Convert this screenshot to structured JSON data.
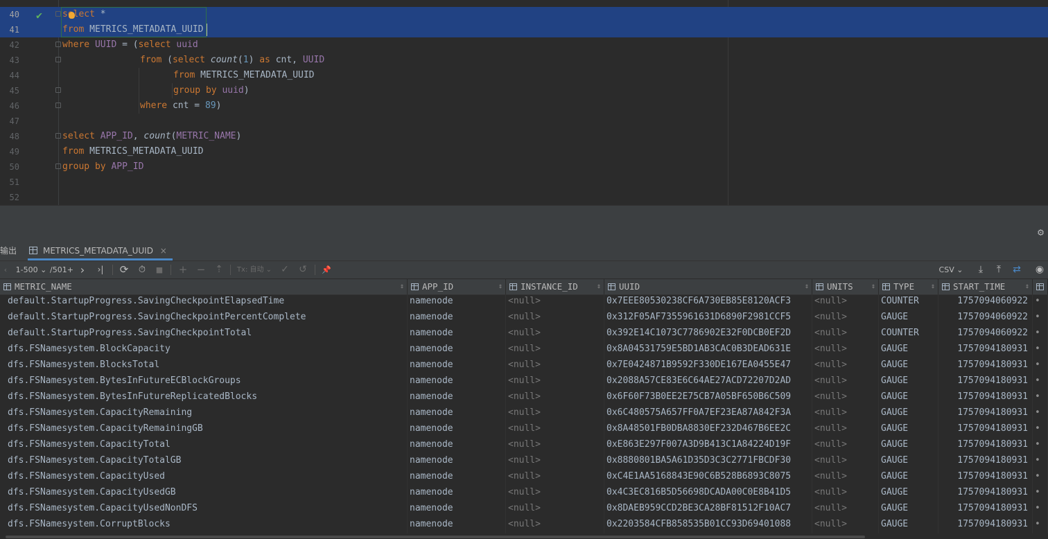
{
  "editor": {
    "lines": [
      {
        "n": "40",
        "sel": true,
        "fold": true,
        "check": true,
        "indent": 0,
        "tokens": [
          {
            "t": "select",
            "c": "kw"
          },
          {
            "t": " *",
            "c": "id"
          }
        ]
      },
      {
        "n": "41",
        "sel": true,
        "fold": false,
        "check": false,
        "indent": 0,
        "tokens": [
          {
            "t": "from",
            "c": "kw"
          },
          {
            "t": " METRICS_METADATA_UUID",
            "c": "id"
          }
        ]
      },
      {
        "n": "42",
        "sel": false,
        "fold": true,
        "check": false,
        "indent": 0,
        "tokens": [
          {
            "t": "where",
            "c": "kw"
          },
          {
            "t": " ",
            "c": "id"
          },
          {
            "t": "UUID",
            "c": "col"
          },
          {
            "t": " = (",
            "c": "id"
          },
          {
            "t": "select",
            "c": "kw"
          },
          {
            "t": " ",
            "c": "id"
          },
          {
            "t": "uuid",
            "c": "col"
          }
        ]
      },
      {
        "n": "43",
        "sel": false,
        "fold": true,
        "check": false,
        "indent": 112,
        "tokens": [
          {
            "t": "from",
            "c": "kw"
          },
          {
            "t": " (",
            "c": "id"
          },
          {
            "t": "select",
            "c": "kw"
          },
          {
            "t": " ",
            "c": "id"
          },
          {
            "t": "count",
            "c": "fn2"
          },
          {
            "t": "(",
            "c": "id"
          },
          {
            "t": "1",
            "c": "num"
          },
          {
            "t": ") ",
            "c": "id"
          },
          {
            "t": "as",
            "c": "kw"
          },
          {
            "t": " cnt, ",
            "c": "id"
          },
          {
            "t": "UUID",
            "c": "col"
          }
        ]
      },
      {
        "n": "44",
        "sel": false,
        "fold": false,
        "check": false,
        "indent": 160,
        "tokens": [
          {
            "t": "from",
            "c": "kw"
          },
          {
            "t": " METRICS_METADATA_UUID",
            "c": "id"
          }
        ]
      },
      {
        "n": "45",
        "sel": false,
        "fold": true,
        "check": false,
        "indent": 160,
        "tokens": [
          {
            "t": "group by",
            "c": "kw"
          },
          {
            "t": " ",
            "c": "id"
          },
          {
            "t": "uuid",
            "c": "col"
          },
          {
            "t": ")",
            "c": "id"
          }
        ]
      },
      {
        "n": "46",
        "sel": false,
        "fold": true,
        "check": false,
        "indent": 112,
        "tokens": [
          {
            "t": "where",
            "c": "kw"
          },
          {
            "t": " cnt = ",
            "c": "id"
          },
          {
            "t": "89",
            "c": "num"
          },
          {
            "t": ")",
            "c": "id"
          }
        ]
      },
      {
        "n": "47",
        "sel": false,
        "fold": false,
        "check": false,
        "indent": 0,
        "tokens": []
      },
      {
        "n": "48",
        "sel": false,
        "fold": true,
        "check": false,
        "indent": 0,
        "tokens": [
          {
            "t": "select",
            "c": "kw"
          },
          {
            "t": " ",
            "c": "id"
          },
          {
            "t": "APP_ID",
            "c": "col"
          },
          {
            "t": ", ",
            "c": "id"
          },
          {
            "t": "count",
            "c": "fn2"
          },
          {
            "t": "(",
            "c": "id"
          },
          {
            "t": "METRIC_NAME",
            "c": "col"
          },
          {
            "t": ")",
            "c": "id"
          }
        ]
      },
      {
        "n": "49",
        "sel": false,
        "fold": false,
        "check": false,
        "indent": 0,
        "tokens": [
          {
            "t": "from",
            "c": "kw"
          },
          {
            "t": " METRICS_METADATA_UUID",
            "c": "id"
          }
        ]
      },
      {
        "n": "50",
        "sel": false,
        "fold": true,
        "check": false,
        "indent": 0,
        "tokens": [
          {
            "t": "group by",
            "c": "kw"
          },
          {
            "t": " ",
            "c": "id"
          },
          {
            "t": "APP_ID",
            "c": "col"
          }
        ]
      },
      {
        "n": "51",
        "sel": false,
        "fold": false,
        "check": false,
        "indent": 0,
        "tokens": []
      },
      {
        "n": "52",
        "sel": false,
        "fold": false,
        "check": false,
        "indent": 0,
        "tokens": []
      }
    ]
  },
  "tabs": {
    "output_label": "输出",
    "table_label": "METRICS_METADATA_UUID",
    "close_glyph": "×"
  },
  "toolbar": {
    "prev_glyph": "‹",
    "page_range": "1-500 ⌄",
    "page_total": "/501+",
    "next_glyph": "›",
    "last_glyph": "›|",
    "reload_glyph": "⟳",
    "history_glyph": "⏱",
    "stop_glyph": "■",
    "add_glyph": "+",
    "delete_glyph": "−",
    "submit_glyph": "⇡",
    "tx_label": "Tx: 自动 ⌄",
    "commit_glyph": "✓",
    "rollback_glyph": "↺",
    "pin_glyph": "📌",
    "export_format": "CSV ⌄",
    "download_glyph": "⤓",
    "upload_glyph": "⤒",
    "compare_glyph": "⇄",
    "view_glyph": "◉"
  },
  "grid": {
    "columns": [
      {
        "name": "METRIC_NAME"
      },
      {
        "name": "APP_ID"
      },
      {
        "name": "INSTANCE_ID"
      },
      {
        "name": "UUID"
      },
      {
        "name": "UNITS"
      },
      {
        "name": "TYPE"
      },
      {
        "name": "START_TIME"
      },
      {
        "name": ""
      }
    ],
    "sort_glyph": "⇕",
    "rows": [
      [
        "default.StartupProgress.SavingCheckpointElapsedTime",
        "namenode",
        "<null>",
        "0x7EEE80530238CF6A730EB85E8120ACF3",
        "<null>",
        "COUNTER",
        "1757094060922"
      ],
      [
        "default.StartupProgress.SavingCheckpointPercentComplete",
        "namenode",
        "<null>",
        "0x312F05AF7355961631D6890F2981CCF5",
        "<null>",
        "GAUGE",
        "1757094060922"
      ],
      [
        "default.StartupProgress.SavingCheckpointTotal",
        "namenode",
        "<null>",
        "0x392E14C1073C7786902E32F0DCB0EF2D",
        "<null>",
        "COUNTER",
        "1757094060922"
      ],
      [
        "dfs.FSNamesystem.BlockCapacity",
        "namenode",
        "<null>",
        "0x8A04531759E5BD1AB3CAC0B3DEAD631E",
        "<null>",
        "GAUGE",
        "1757094180931"
      ],
      [
        "dfs.FSNamesystem.BlocksTotal",
        "namenode",
        "<null>",
        "0x7E0424871B9592F330DE167EA0455E47",
        "<null>",
        "GAUGE",
        "1757094180931"
      ],
      [
        "dfs.FSNamesystem.BytesInFutureECBlockGroups",
        "namenode",
        "<null>",
        "0x2088A57CE83E6C64AE27ACD72207D2AD",
        "<null>",
        "GAUGE",
        "1757094180931"
      ],
      [
        "dfs.FSNamesystem.BytesInFutureReplicatedBlocks",
        "namenode",
        "<null>",
        "0x6F60F73B0EE2E75CB7A05BF650B6C509",
        "<null>",
        "GAUGE",
        "1757094180931"
      ],
      [
        "dfs.FSNamesystem.CapacityRemaining",
        "namenode",
        "<null>",
        "0x6C480575A657FF0A7EF23EA87A842F3A",
        "<null>",
        "GAUGE",
        "1757094180931"
      ],
      [
        "dfs.FSNamesystem.CapacityRemainingGB",
        "namenode",
        "<null>",
        "0x8A48501FB0DBA8830EF232D467B6EE2C",
        "<null>",
        "GAUGE",
        "1757094180931"
      ],
      [
        "dfs.FSNamesystem.CapacityTotal",
        "namenode",
        "<null>",
        "0xE863E297F007A3D9B413C1A84224D19F",
        "<null>",
        "GAUGE",
        "1757094180931"
      ],
      [
        "dfs.FSNamesystem.CapacityTotalGB",
        "namenode",
        "<null>",
        "0x8880801BA5A61D35D3C3C2771FBCDF30",
        "<null>",
        "GAUGE",
        "1757094180931"
      ],
      [
        "dfs.FSNamesystem.CapacityUsed",
        "namenode",
        "<null>",
        "0xC4E1AA5168843E90C6B528B6893C8075",
        "<null>",
        "GAUGE",
        "1757094180931"
      ],
      [
        "dfs.FSNamesystem.CapacityUsedGB",
        "namenode",
        "<null>",
        "0x4C3EC816B5D56698DCADA00C0E8B41D5",
        "<null>",
        "GAUGE",
        "1757094180931"
      ],
      [
        "dfs.FSNamesystem.CapacityUsedNonDFS",
        "namenode",
        "<null>",
        "0x8DAEB959CCD2BE3CA28BF81512F10AC7",
        "<null>",
        "GAUGE",
        "1757094180931"
      ],
      [
        "dfs.FSNamesystem.CorruptBlocks",
        "namenode",
        "<null>",
        "0x2203584CFB858535B01CC93D69401088",
        "<null>",
        "GAUGE",
        "1757094180931"
      ]
    ]
  },
  "gear_glyph": "⚙"
}
